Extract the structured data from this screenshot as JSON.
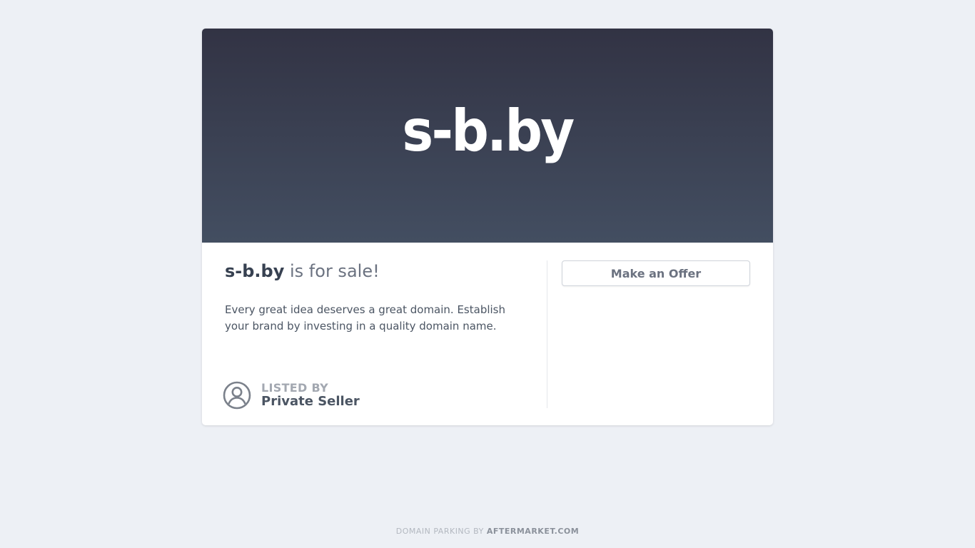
{
  "hero": {
    "domain": "s-b.by"
  },
  "sale": {
    "domain": "s-b.by",
    "suffix": " is for sale!"
  },
  "description": "Every great idea deserves a great domain. Establish your brand by investing in a quality domain name.",
  "offer_button": {
    "label": "Make an Offer"
  },
  "seller": {
    "listed_by_label": "LISTED BY",
    "name": "Private Seller",
    "icon": "user-circle-icon"
  },
  "footer": {
    "prefix": "DOMAIN PARKING BY ",
    "brand": "AFTERMARKET.COM"
  },
  "colors": {
    "page_background": "#edf0f5",
    "hero_gradient_top": "#323344",
    "hero_gradient_bottom": "#434e61",
    "text_dark": "#374151",
    "text_muted": "#6b7280"
  }
}
